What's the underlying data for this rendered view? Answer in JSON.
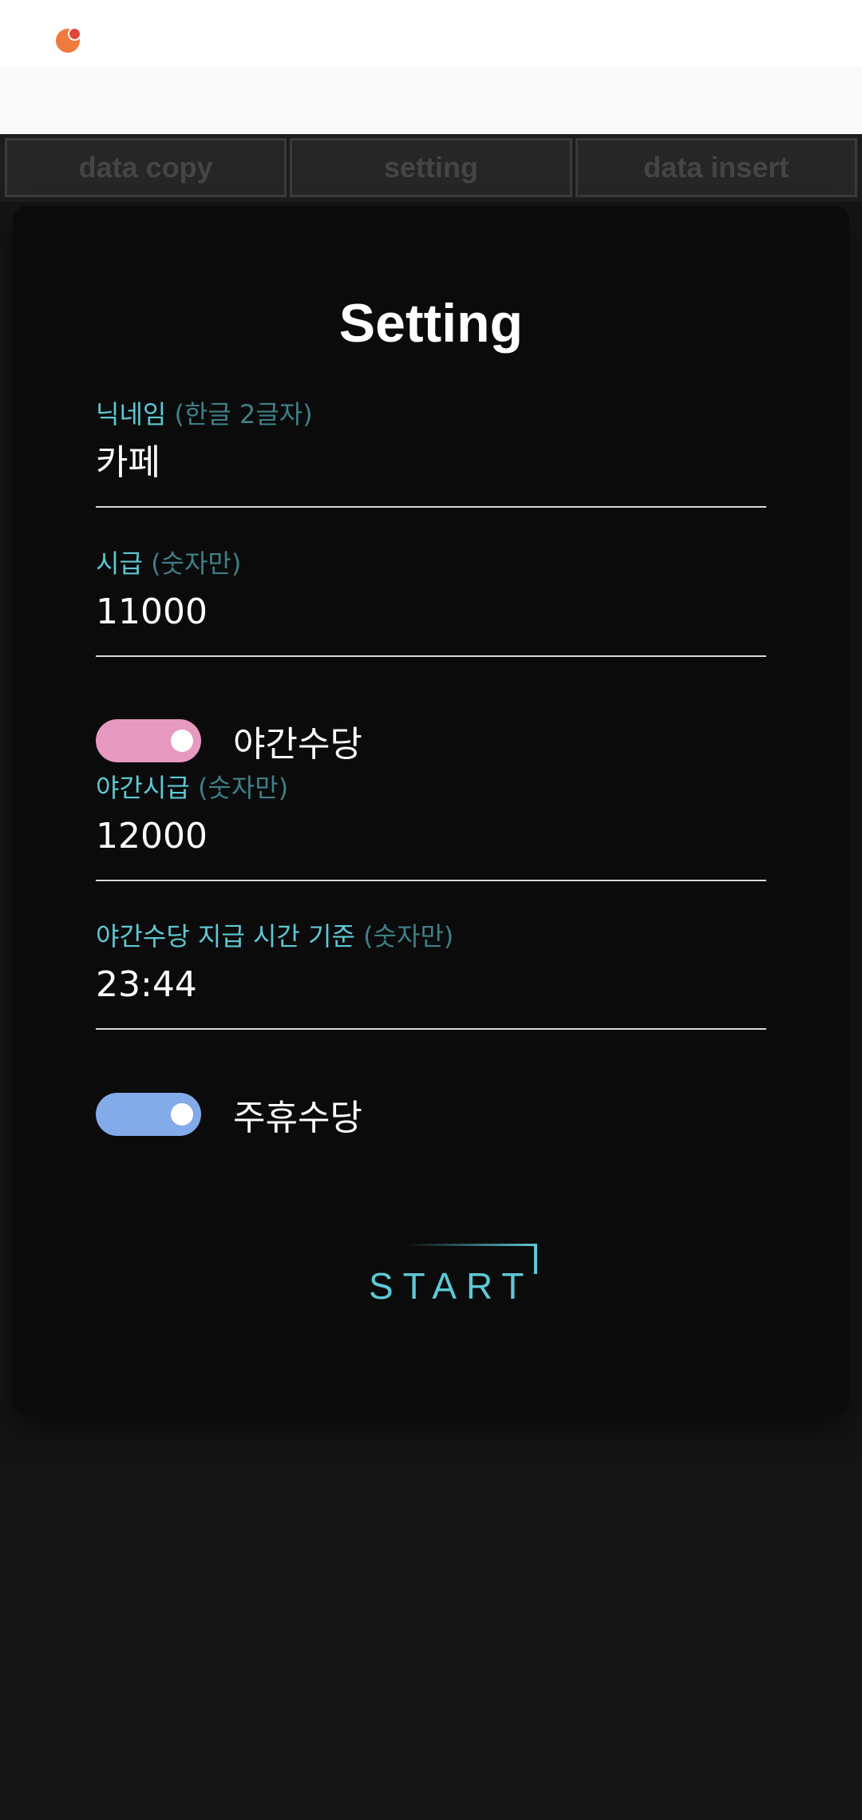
{
  "tabs": [
    {
      "label": "data copy"
    },
    {
      "label": "setting"
    },
    {
      "label": "data insert"
    }
  ],
  "card": {
    "title": "Setting",
    "fields": [
      {
        "label": "닉네임",
        "hint": "(한글 2글자)",
        "value": "카페"
      },
      {
        "label": "시급",
        "hint": "(숫자만)",
        "value": "11000"
      },
      {
        "label": "야간시급",
        "hint": "(숫자만)",
        "value": "12000"
      },
      {
        "label": "야간수당 지급 시간 기준",
        "hint": "(숫자만)",
        "value": "23:44"
      }
    ],
    "toggles": [
      {
        "label": "야간수당",
        "on": true,
        "color": "#e899bf"
      },
      {
        "label": "주휴수당",
        "on": true,
        "color": "#83abea"
      }
    ],
    "start_label": "START"
  },
  "colors": {
    "accent": "#5ec8d4",
    "background": "#151515",
    "card": "#0b0b0b"
  }
}
